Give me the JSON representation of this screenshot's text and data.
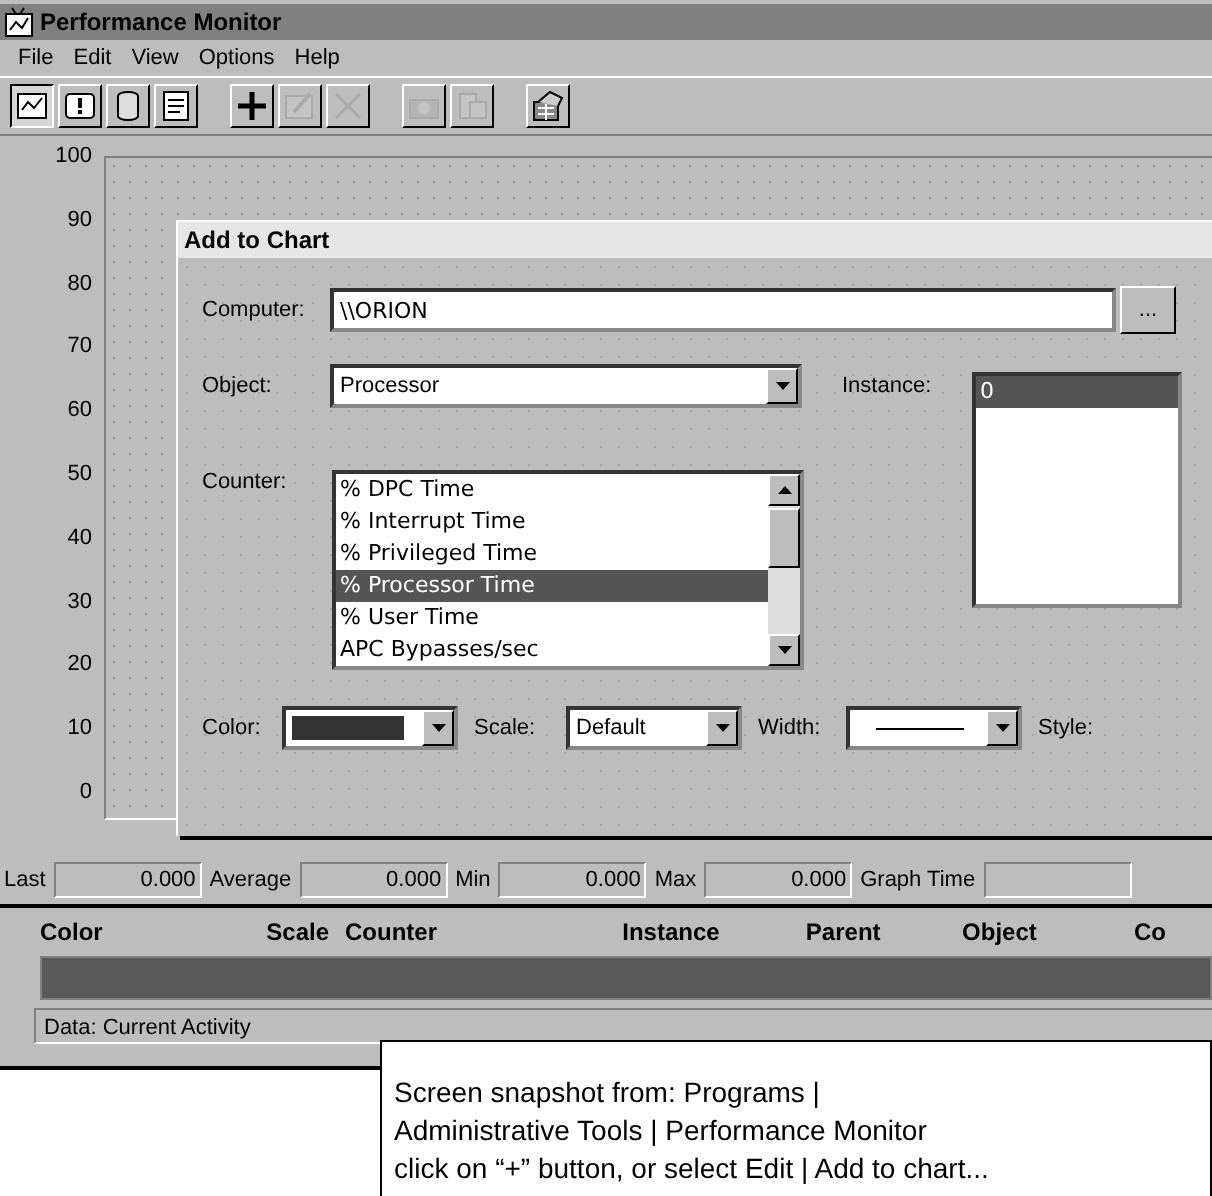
{
  "window": {
    "title": "Performance Monitor"
  },
  "menu": [
    "File",
    "Edit",
    "View",
    "Options",
    "Help"
  ],
  "toolbar": [
    {
      "kind": "chart",
      "selected": true,
      "disabled": false
    },
    {
      "kind": "alert",
      "selected": false,
      "disabled": false
    },
    {
      "kind": "log",
      "selected": false,
      "disabled": false
    },
    {
      "kind": "report",
      "selected": false,
      "disabled": false
    },
    {
      "kind": "add",
      "selected": false,
      "disabled": false
    },
    {
      "kind": "edit",
      "selected": false,
      "disabled": true
    },
    {
      "kind": "delete",
      "selected": false,
      "disabled": true
    },
    {
      "kind": "snapshot",
      "selected": false,
      "disabled": true
    },
    {
      "kind": "bookmark",
      "selected": false,
      "disabled": true
    },
    {
      "kind": "options",
      "selected": false,
      "disabled": false
    }
  ],
  "chart": {
    "y_labels": [
      "100",
      "90",
      "80",
      "70",
      "60",
      "50",
      "40",
      "30",
      "20",
      "10",
      "0"
    ]
  },
  "dialog": {
    "title": "Add to Chart",
    "computer": {
      "label": "Computer:",
      "value": "\\\\ORION",
      "button": "..."
    },
    "object": {
      "label": "Object:",
      "value": "Processor"
    },
    "instance": {
      "label": "Instance:",
      "items": [
        {
          "text": "0",
          "selected": true
        }
      ]
    },
    "counter": {
      "label": "Counter:",
      "items": [
        {
          "text": "% DPC Time",
          "selected": false
        },
        {
          "text": "% Interrupt Time",
          "selected": false
        },
        {
          "text": "% Privileged Time",
          "selected": false
        },
        {
          "text": "% Processor Time",
          "selected": true
        },
        {
          "text": "% User Time",
          "selected": false
        },
        {
          "text": "APC Bypasses/sec",
          "selected": false
        }
      ]
    },
    "color": {
      "label": "Color:"
    },
    "scale": {
      "label": "Scale:",
      "value": "Default"
    },
    "width": {
      "label": "Width:"
    },
    "style": {
      "label": "Style:"
    }
  },
  "stats": [
    {
      "label": "Last",
      "value": "0.000"
    },
    {
      "label": "Average",
      "value": "0.000"
    },
    {
      "label": "Min",
      "value": "0.000"
    },
    {
      "label": "Max",
      "value": "0.000"
    },
    {
      "label": "Graph Time"
    }
  ],
  "legend": {
    "columns": [
      "Color",
      "Scale",
      "Counter",
      "Instance",
      "Parent",
      "Object",
      "Co"
    ],
    "rows": [
      {
        "selected": true
      }
    ]
  },
  "status_bar": "Data: Current Activity",
  "caption": [
    "Screen snapshot from:  Programs |",
    "Administrative Tools | Performance Monitor",
    "click on “+” button, or select Edit | Add to chart..."
  ]
}
